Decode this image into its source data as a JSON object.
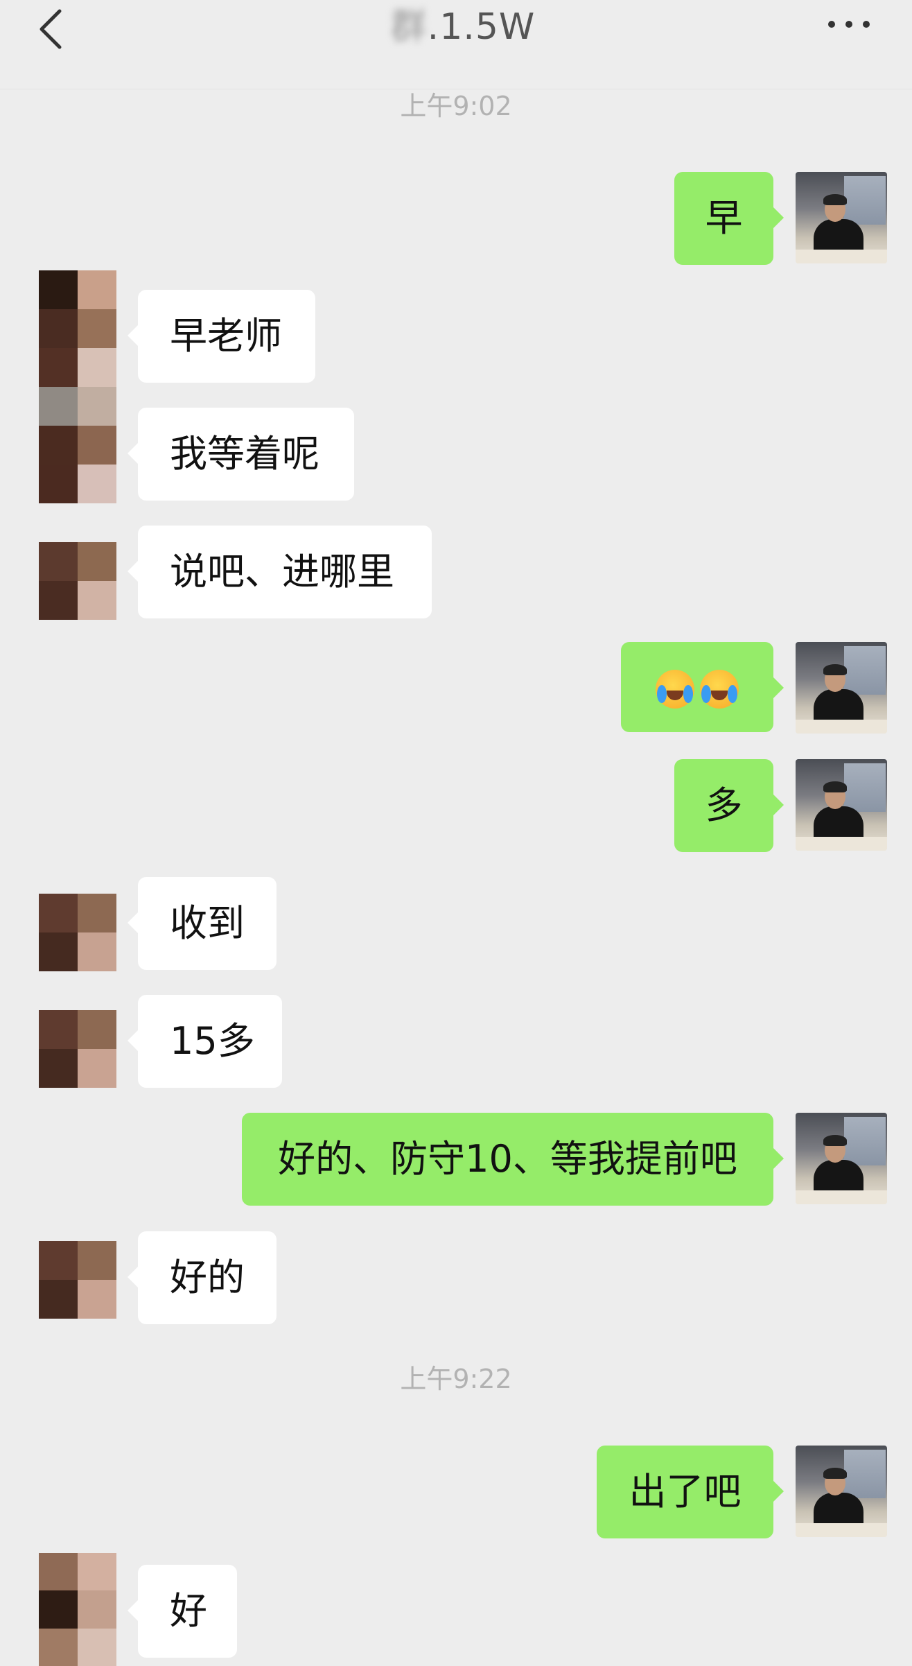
{
  "header": {
    "back_icon": "chevron-left-icon",
    "title_hidden_prefix": "群",
    "title_visible": ".1.5W",
    "more_icon": "ellipsis-icon"
  },
  "timestamps": [
    "上午9:02",
    "上午9:22"
  ],
  "messages": [
    {
      "side": "out",
      "text": "早"
    },
    {
      "side": "in",
      "text": "早老师"
    },
    {
      "side": "in",
      "text": "我等着呢"
    },
    {
      "side": "in",
      "text": "说吧、进哪里"
    },
    {
      "side": "out",
      "text": "",
      "emojis": [
        "loudly-crying-face-emoji",
        "loudly-crying-face-emoji"
      ]
    },
    {
      "side": "out",
      "text": "多"
    },
    {
      "side": "in",
      "text": "收到"
    },
    {
      "side": "in",
      "text": "15多"
    },
    {
      "side": "out",
      "text": "好的、防守10、等我提前吧"
    },
    {
      "side": "in",
      "text": "好的"
    },
    {
      "side": "out",
      "text": "出了吧"
    },
    {
      "side": "in",
      "text": "好"
    }
  ],
  "colors": {
    "background": "#ededed",
    "outgoing_bubble": "#95ec69",
    "incoming_bubble": "#ffffff",
    "timestamp_text": "#b2b2b2"
  }
}
